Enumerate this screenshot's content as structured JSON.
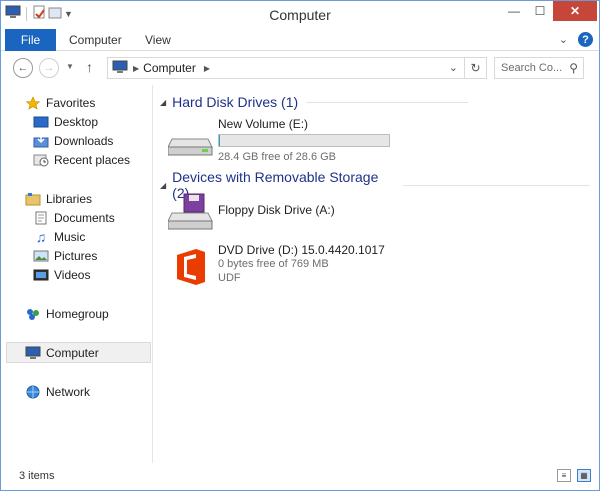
{
  "window": {
    "title": "Computer"
  },
  "ribbon": {
    "tabs": [
      {
        "label": "File"
      },
      {
        "label": "Computer"
      },
      {
        "label": "View"
      }
    ]
  },
  "address": {
    "path": "Computer",
    "search_placeholder": "Search Co..."
  },
  "nav": {
    "favorites": "Favorites",
    "desktop": "Desktop",
    "downloads": "Downloads",
    "recent": "Recent places",
    "libraries": "Libraries",
    "documents": "Documents",
    "music": "Music",
    "pictures": "Pictures",
    "videos": "Videos",
    "homegroup": "Homegroup",
    "computer": "Computer",
    "network": "Network"
  },
  "groups": {
    "hdd": "Hard Disk Drives (1)",
    "removable": "Devices with Removable Storage (2)"
  },
  "drives": {
    "volume_e": {
      "name": "New Volume (E:)",
      "free": "28.4 GB free of 28.6 GB",
      "used_fraction": 0.007
    },
    "floppy": {
      "name": "Floppy Disk Drive (A:)"
    },
    "dvd": {
      "name": "DVD Drive (D:) 15.0.4420.1017",
      "free": "0 bytes free of 769 MB",
      "fs": "UDF"
    }
  },
  "status": {
    "count": "3 items"
  },
  "colors": {
    "accent": "#1a65c0",
    "header": "#1e3287",
    "office": "#eb3c00"
  }
}
